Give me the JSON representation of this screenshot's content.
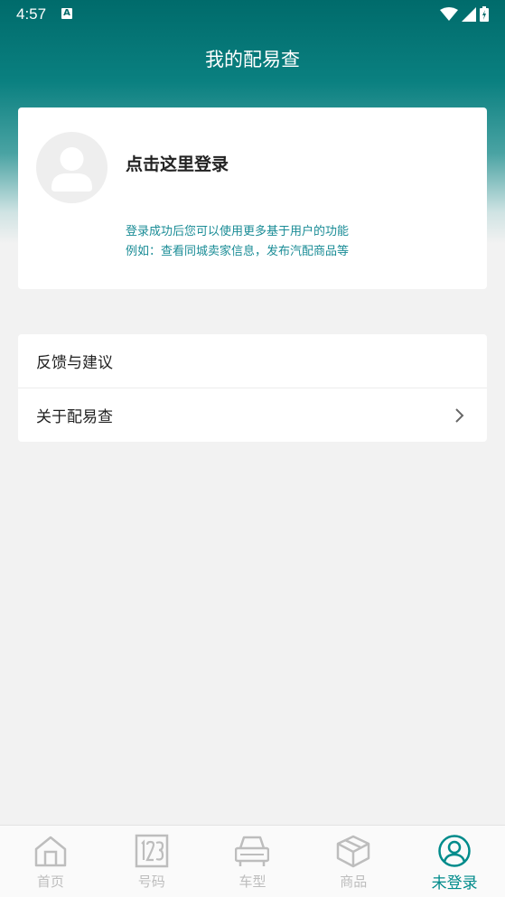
{
  "status": {
    "time": "4:57",
    "notification_icon": "A"
  },
  "header": {
    "title": "我的配易查"
  },
  "login_card": {
    "title": "点击这里登录",
    "desc_line1": "登录成功后您可以使用更多基于用户的功能",
    "desc_line2": "例如：查看同城卖家信息，发布汽配商品等"
  },
  "menu": {
    "items": [
      {
        "label": "反馈与建议"
      },
      {
        "label": "关于配易查"
      }
    ]
  },
  "tabbar": {
    "tabs": [
      {
        "label": "首页",
        "icon": "home-icon"
      },
      {
        "label": "号码",
        "icon": "number-icon"
      },
      {
        "label": "车型",
        "icon": "car-icon"
      },
      {
        "label": "商品",
        "icon": "box-icon"
      },
      {
        "label": "未登录",
        "icon": "user-icon"
      }
    ],
    "active_index": 4
  },
  "colors": {
    "accent": "#008b8b",
    "header_top": "#006b6b",
    "link_text": "#1a8c96",
    "inactive_tab": "#bdbdbd"
  }
}
